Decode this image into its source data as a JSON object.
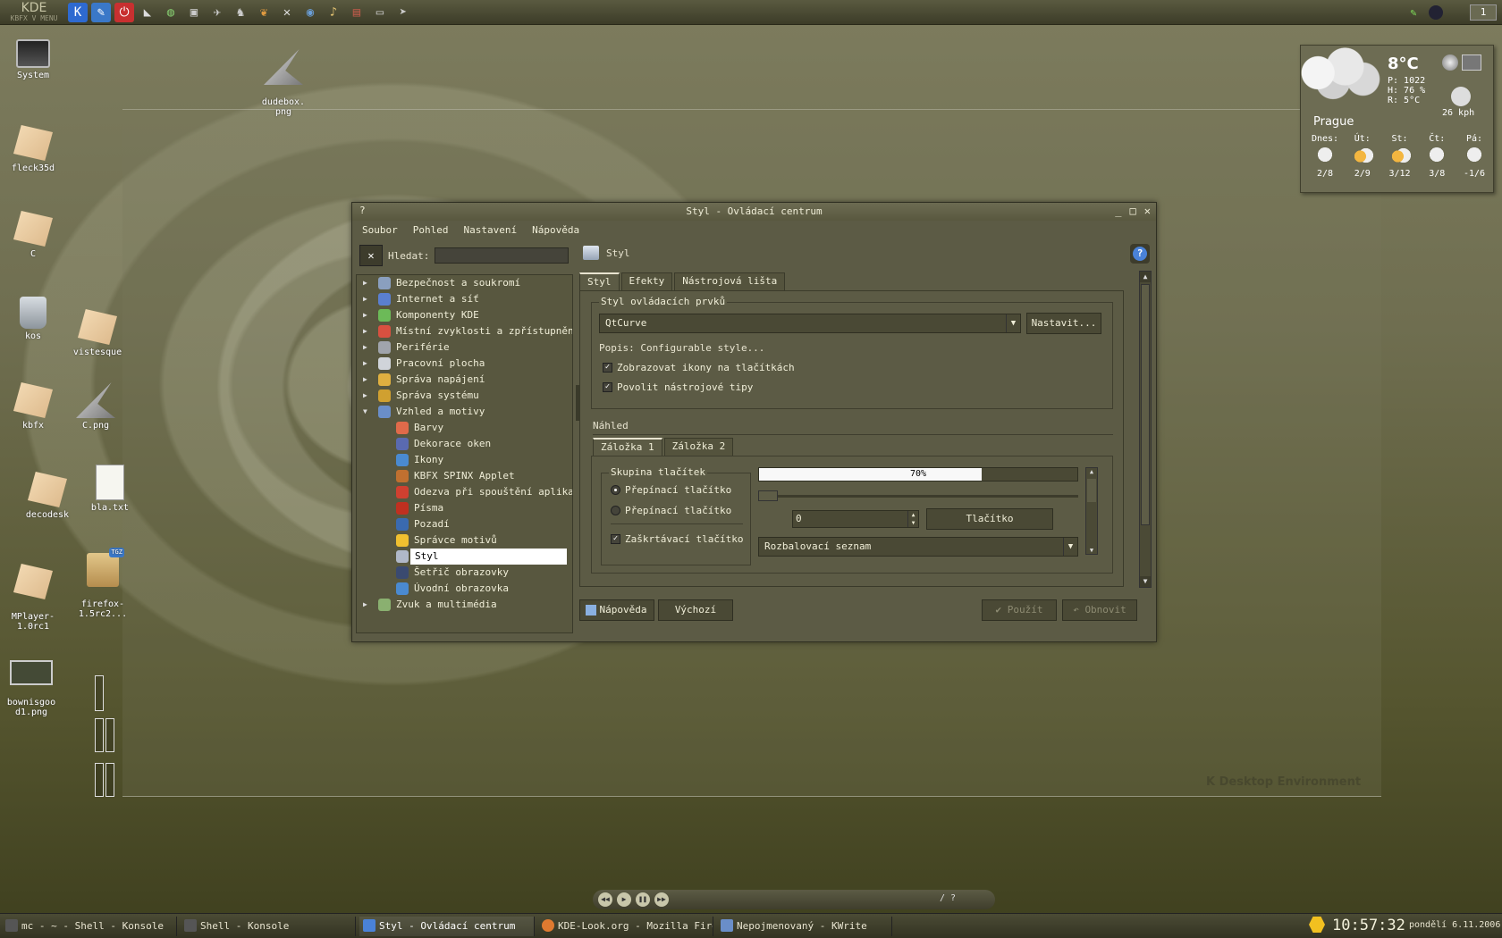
{
  "top_panel": {
    "kde_title": "KDE",
    "kde_subtitle": "KBFX V MENU",
    "quick_launch": [
      "kde-menu-icon",
      "kwrite-icon",
      "power-icon",
      "shark-icon",
      "globe-icon",
      "monitor-icon",
      "plane-icon",
      "figure-icon",
      "dragon-icon",
      "tools-icon",
      "firefox-icon",
      "scroll-icon",
      "film-icon",
      "screen-icon",
      "arrow-icon"
    ],
    "pager_desktop": "1"
  },
  "desktop_icons": [
    {
      "label": "System",
      "type": "monitor"
    },
    {
      "label": "dudebox.\npng",
      "type": "shark"
    },
    {
      "label": "fleck35d",
      "type": "folder"
    },
    {
      "label": "C",
      "type": "folder"
    },
    {
      "label": "kos",
      "type": "trash"
    },
    {
      "label": "vistesque",
      "type": "folder"
    },
    {
      "label": "kbfx",
      "type": "folder"
    },
    {
      "label": "C.png",
      "type": "shark"
    },
    {
      "label": "decodesk",
      "type": "folder"
    },
    {
      "label": "bla.txt",
      "type": "doc"
    },
    {
      "label": "MPlayer-\n1.0rc1",
      "type": "folder"
    },
    {
      "label": "firefox-\n1.5rc2...",
      "type": "tgz"
    },
    {
      "label": "bownisgoo\nd1.png",
      "type": "thumb"
    }
  ],
  "tgz_badge": "TGZ",
  "weather": {
    "temp": "8°C",
    "pressure": "P: 1022",
    "humidity": "H: 76 %",
    "dewpoint": "R: 5°C",
    "wind": "26 kph",
    "city": "Prague",
    "days": [
      {
        "name": "Dnes:",
        "range": "2/8"
      },
      {
        "name": "Út:",
        "range": "2/9"
      },
      {
        "name": "St:",
        "range": "3/12"
      },
      {
        "name": "Čt:",
        "range": "3/8"
      },
      {
        "name": "Pá:",
        "range": "-1/6"
      }
    ]
  },
  "window": {
    "help_char": "?",
    "title": "Styl - Ovládací centrum",
    "controls": [
      "_",
      "□",
      "✕"
    ],
    "menu": [
      "Soubor",
      "Pohled",
      "Nastavení",
      "Nápověda"
    ],
    "search_label": "Hledat:",
    "search_value": "",
    "tree": [
      {
        "label": "Bezpečnost a soukromí",
        "level": 0,
        "arrow": "▶",
        "color": "#8a9fbf"
      },
      {
        "label": "Internet a síť",
        "level": 0,
        "arrow": "▶",
        "color": "#5a7fd0"
      },
      {
        "label": "Komponenty KDE",
        "level": 0,
        "arrow": "▶",
        "color": "#6cba58"
      },
      {
        "label": "Místní zvyklosti a zpřístupnění",
        "level": 0,
        "arrow": "▶",
        "color": "#d85040"
      },
      {
        "label": "Periférie",
        "level": 0,
        "arrow": "▶",
        "color": "#a0a4ac"
      },
      {
        "label": "Pracovní plocha",
        "level": 0,
        "arrow": "▶",
        "color": "#d0d4da"
      },
      {
        "label": "Správa napájení",
        "level": 0,
        "arrow": "▶",
        "color": "#e0b040"
      },
      {
        "label": "Správa systému",
        "level": 0,
        "arrow": "▶",
        "color": "#d0a030"
      },
      {
        "label": "Vzhled a motivy",
        "level": 0,
        "arrow": "▼",
        "color": "#6a8ec8"
      },
      {
        "label": "Barvy",
        "level": 1,
        "arrow": "",
        "color": "#e06a4a"
      },
      {
        "label": "Dekorace oken",
        "level": 1,
        "arrow": "",
        "color": "#5a6ab0"
      },
      {
        "label": "Ikony",
        "level": 1,
        "arrow": "",
        "color": "#4a8ad0"
      },
      {
        "label": "KBFX SPINX Applet",
        "level": 1,
        "arrow": "",
        "color": "#c07030"
      },
      {
        "label": "Odezva při spouštění aplikací",
        "level": 1,
        "arrow": "",
        "color": "#d04030"
      },
      {
        "label": "Písma",
        "level": 1,
        "arrow": "",
        "color": "#c03020"
      },
      {
        "label": "Pozadí",
        "level": 1,
        "arrow": "",
        "color": "#3a6ab0"
      },
      {
        "label": "Správce motivů",
        "level": 1,
        "arrow": "",
        "color": "#f0c030"
      },
      {
        "label": "Styl",
        "level": 1,
        "arrow": "",
        "color": "#b0b8c8",
        "selected": true
      },
      {
        "label": "Šetřič obrazovky",
        "level": 1,
        "arrow": "",
        "color": "#3a4a70"
      },
      {
        "label": "Úvodní obrazovka",
        "level": 1,
        "arrow": "",
        "color": "#4a8ad0"
      },
      {
        "label": "Zvuk a multimédia",
        "level": 0,
        "arrow": "▶",
        "color": "#8ab070"
      }
    ],
    "panel_title": "Styl",
    "tabs": [
      "Styl",
      "Efekty",
      "Nástrojová lišta"
    ],
    "widget_style_group": "Styl ovládacích prvků",
    "style_combo": "QtCurve",
    "configure_button": "Nastavit...",
    "description": "Popis: Configurable style...",
    "check_icons": "Zobrazovat ikony na tlačítkách",
    "check_tooltips": "Povolit nástrojové tipy",
    "preview_label": "Náhled",
    "preview_tabs": [
      "Záložka 1",
      "Záložka 2"
    ],
    "button_group": "Skupina tlačítek",
    "radio1": "Přepínací tlačítko",
    "radio2": "Přepínací tlačítko",
    "checkbox": "Zaškrtávací tlačítko",
    "progress_text": "70%",
    "progress_value": 0.7,
    "spin_value": "0",
    "button_label": "Tlačítko",
    "dropdown": "Rozbalovací seznam",
    "help_button": "Nápověda",
    "default_button": "Výchozí",
    "apply_button": "Použít",
    "reset_button": "Obnovit"
  },
  "media_bar": {
    "time": "/ ?"
  },
  "taskbar": {
    "tasks": [
      {
        "label": "mc - ~ - Shell - Konsole",
        "color": "#555"
      },
      {
        "label": "Shell - Konsole",
        "color": "#555"
      },
      {
        "label": "Styl - Ovládací centrum",
        "color": "#4a82d8"
      },
      {
        "label": "KDE-Look.org - Mozilla Firef",
        "color": "#e07a30"
      },
      {
        "label": "Nepojmenovaný - KWrite",
        "color": "#6a8ec8"
      }
    ],
    "clock": "10:57:32",
    "date": "pondělí 6.11.2006"
  },
  "watermark": "K Desktop Environment"
}
